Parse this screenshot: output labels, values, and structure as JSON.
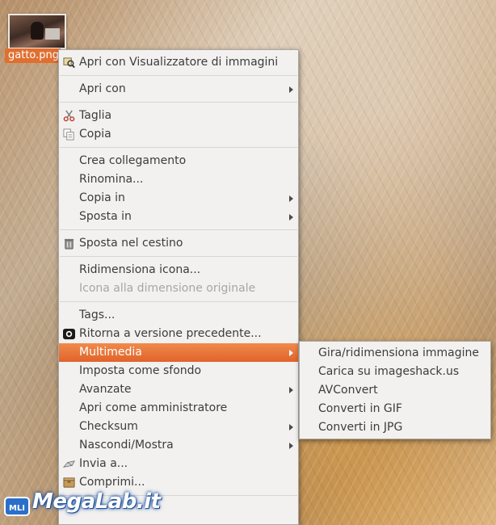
{
  "desktop": {
    "file_label": "gatto.png"
  },
  "context_menu": {
    "items": [
      {
        "label": "Apri con Visualizzatore di immagini",
        "icon": "image-viewer-icon"
      },
      {
        "label": "Apri con",
        "submenu": true
      },
      {
        "label": "Taglia",
        "icon": "scissors-icon"
      },
      {
        "label": "Copia",
        "icon": "copy-icon"
      },
      {
        "label": "Crea collegamento"
      },
      {
        "label": "Rinomina..."
      },
      {
        "label": "Copia in",
        "submenu": true
      },
      {
        "label": "Sposta in",
        "submenu": true
      },
      {
        "label": "Sposta nel cestino",
        "icon": "trash-icon"
      },
      {
        "label": "Ridimensiona icona..."
      },
      {
        "label": "Icona alla dimensione originale",
        "disabled": true
      },
      {
        "label": "Tags..."
      },
      {
        "label": "Ritorna a versione precedente...",
        "icon": "camera-icon"
      },
      {
        "label": "Multimedia",
        "submenu": true,
        "highlighted": true
      },
      {
        "label": "Imposta come sfondo"
      },
      {
        "label": "Avanzate",
        "submenu": true
      },
      {
        "label": "Apri come amministratore"
      },
      {
        "label": "Checksum",
        "submenu": true
      },
      {
        "label": "Nascondi/Mostra",
        "submenu": true
      },
      {
        "label": "Invia a...",
        "icon": "send-icon"
      },
      {
        "label": "Comprimi...",
        "icon": "archive-icon"
      }
    ]
  },
  "multimedia_submenu": {
    "items": [
      "Gira/ridimensiona immagine",
      "Carica su imageshack.us",
      "AVConvert",
      "Converti in GIF",
      "Converti in JPG"
    ]
  },
  "watermark": {
    "text": "MegaLab.it",
    "badge": "MLI"
  },
  "colors": {
    "highlight": "#e8733a",
    "menu_bg": "#f2f1f0",
    "label_bg": "#e06f30"
  }
}
